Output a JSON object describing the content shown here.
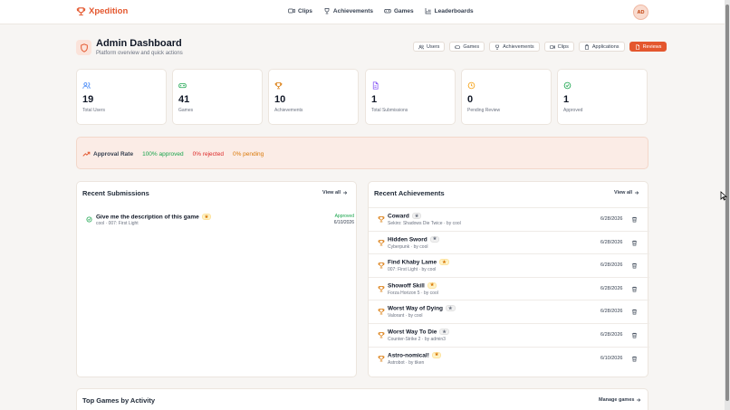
{
  "app": {
    "name": "Xpedition",
    "brand_color": "#e4572e"
  },
  "nav": [
    {
      "label": "Clips",
      "icon": "video-icon"
    },
    {
      "label": "Achievements",
      "icon": "trophy-icon"
    },
    {
      "label": "Games",
      "icon": "gamepad-icon"
    },
    {
      "label": "Leaderboards",
      "icon": "bar-chart-icon"
    }
  ],
  "user": {
    "initials": "AD"
  },
  "header": {
    "title": "Admin Dashboard",
    "subtitle": "Platform overview and quick actions"
  },
  "actions": [
    {
      "label": "Users",
      "icon": "users-icon"
    },
    {
      "label": "Games",
      "icon": "gamepad-icon"
    },
    {
      "label": "Achievements",
      "icon": "trophy-icon"
    },
    {
      "label": "Clips",
      "icon": "video-icon"
    },
    {
      "label": "Applications",
      "icon": "clipboard-icon"
    },
    {
      "label": "Reviews",
      "icon": "file-icon"
    }
  ],
  "stats": [
    {
      "value": "19",
      "label": "Total Users",
      "icon": "users-icon",
      "color": "#3b82f6"
    },
    {
      "value": "41",
      "label": "Games",
      "icon": "gamepad-icon",
      "color": "#16a34a"
    },
    {
      "value": "10",
      "label": "Achievements",
      "icon": "trophy-icon",
      "color": "#d97706"
    },
    {
      "value": "1",
      "label": "Total Submissions",
      "icon": "file-icon",
      "color": "#8b5cf6"
    },
    {
      "value": "0",
      "label": "Pending Review",
      "icon": "clock-icon",
      "color": "#f59e0b"
    },
    {
      "value": "1",
      "label": "Approved",
      "icon": "check-circle-icon",
      "color": "#16a34a"
    }
  ],
  "approval": {
    "title": "Approval Rate",
    "approved": "100% approved",
    "rejected": "0% rejected",
    "pending": "0% pending",
    "colors": {
      "approved": "#16a34a",
      "rejected": "#dc2626",
      "pending": "#d97706"
    }
  },
  "recent_submissions": {
    "title": "Recent Submissions",
    "view_all": "View all",
    "items": [
      {
        "title": "Give me the description of this game",
        "meta": "cool · 007: First Light",
        "status": "Approved",
        "date": "6/10/2026",
        "rarity": "gold"
      }
    ]
  },
  "recent_achievements": {
    "title": "Recent Achievements",
    "view_all": "View all",
    "items": [
      {
        "title": "Coward",
        "meta": "Sekiro: Shadows Die Twice · by cool",
        "date": "6/28/2026",
        "rarity": "gray"
      },
      {
        "title": "Hidden Sword",
        "meta": "Cyberpunk · by cool",
        "date": "6/28/2026",
        "rarity": "gray"
      },
      {
        "title": "Find Khaby Lame",
        "meta": "007: First Light · by cool",
        "date": "6/28/2026",
        "rarity": "gold"
      },
      {
        "title": "Showoff Skill",
        "meta": "Forza Horizon 5 · by cool",
        "date": "6/28/2026",
        "rarity": "gold"
      },
      {
        "title": "Worst Way of Dying",
        "meta": "Valorant · by cool",
        "date": "6/28/2026",
        "rarity": "gray"
      },
      {
        "title": "Worst Way To Die",
        "meta": "Counter-Strike 2 · by admin3",
        "date": "6/28/2026",
        "rarity": "gray"
      },
      {
        "title": "Astro-nomical!",
        "meta": "Astrobot · by tiken",
        "date": "6/10/2026",
        "rarity": "gold"
      }
    ]
  },
  "top_games": {
    "title": "Top Games by Activity",
    "manage": "Manage games"
  },
  "icons": {
    "star": "★"
  }
}
